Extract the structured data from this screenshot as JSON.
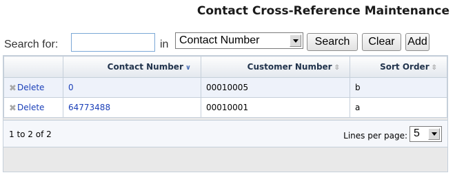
{
  "page": {
    "title": "Contact Cross-Reference Maintenance"
  },
  "search": {
    "label": "Search for:",
    "value": "",
    "in_label": "in",
    "field_selected": "Contact Number",
    "buttons": {
      "search": "Search",
      "clear": "Clear",
      "add": "Add"
    }
  },
  "table": {
    "headers": {
      "contact": "Contact Number",
      "customer": "Customer Number",
      "sort": "Sort Order"
    },
    "rows": [
      {
        "action": "Delete",
        "contact": "0",
        "customer": "00010005",
        "sort": "b"
      },
      {
        "action": "Delete",
        "contact": "64773488",
        "customer": "00010001",
        "sort": "a"
      }
    ]
  },
  "pager": {
    "range": "1 to 2 of 2",
    "lines_label": "Lines per page:",
    "lines_value": "5"
  },
  "icons": {
    "sort_active": "chevron-down-icon",
    "sort_inactive": "sort-updown-icon",
    "delete": "delete-x-icon"
  }
}
